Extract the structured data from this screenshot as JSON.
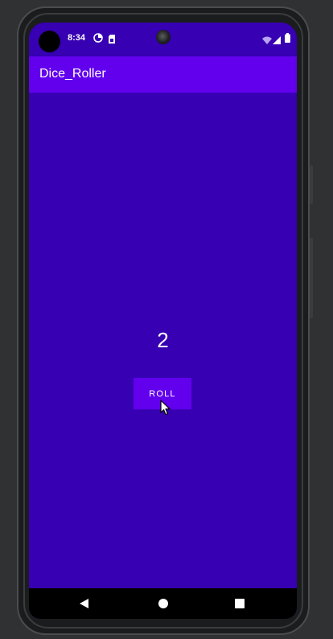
{
  "status_bar": {
    "time": "8:34",
    "icons": [
      "punch-hole-camera",
      "data-saver-icon",
      "sim-card-icon",
      "wifi-icon",
      "signal-icon",
      "battery-icon"
    ]
  },
  "app_bar": {
    "title": "Dice_Roller"
  },
  "main": {
    "dice_value": "2",
    "roll_button_label": "ROLL"
  },
  "nav_bar": {
    "buttons": [
      "back-icon",
      "home-icon",
      "recents-icon"
    ]
  },
  "colors": {
    "primary": "#6200ee",
    "primary_dark": "#3700b3",
    "on_primary": "#ffffff",
    "nav_background": "#000000",
    "device_frame": "#1b1c1e",
    "background": "#2f3133"
  }
}
